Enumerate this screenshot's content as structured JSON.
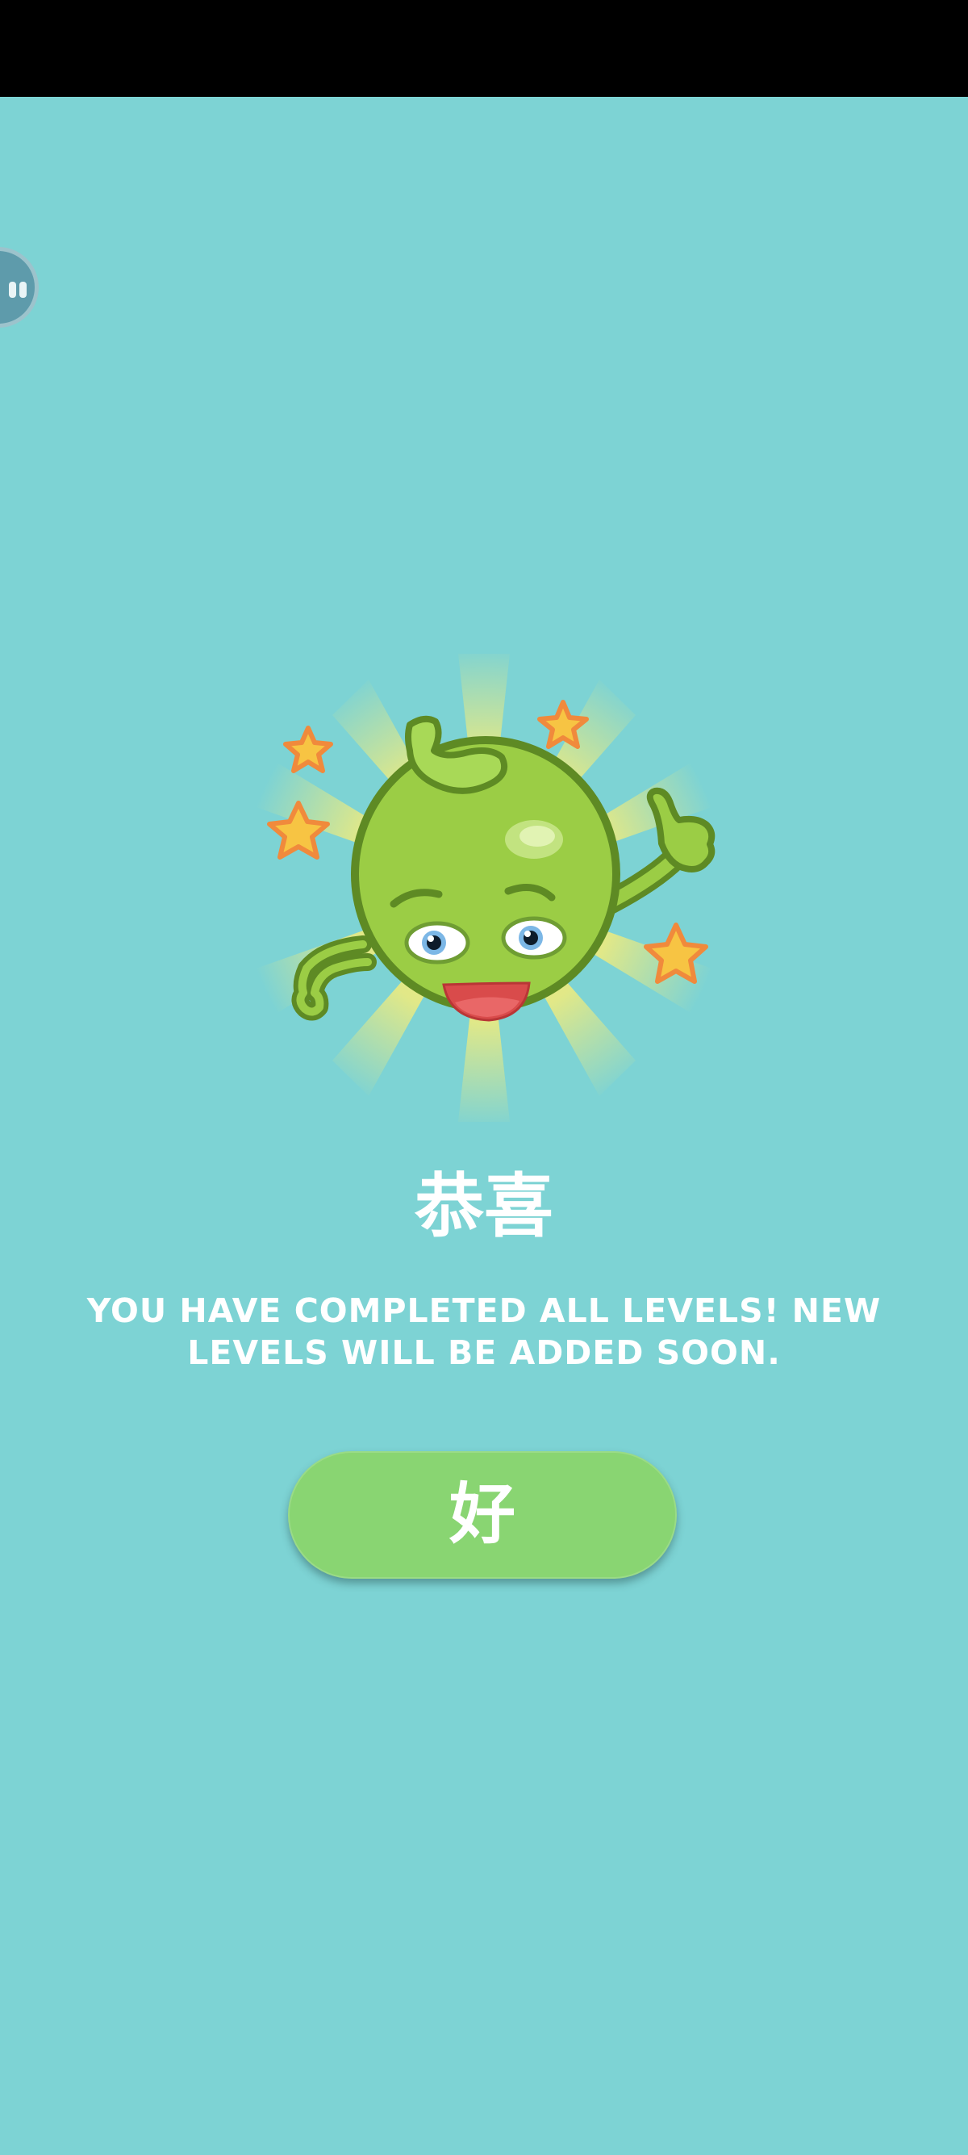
{
  "dialog": {
    "title": "恭喜",
    "message": "YOU HAVE COMPLETED ALL LEVELS! NEW LEVELS WILL BE ADDED SOON.",
    "ok_label": "好"
  },
  "colors": {
    "background": "#7dd3d4",
    "button": "#89d572",
    "mascot_body": "#9bcd45",
    "mascot_outline": "#5e8a24",
    "star": "#f7c443",
    "star_outline": "#f08a3c"
  },
  "icons": {
    "mascot": "green-pea-mascot",
    "bubble": "floating-assistant-bubble"
  }
}
